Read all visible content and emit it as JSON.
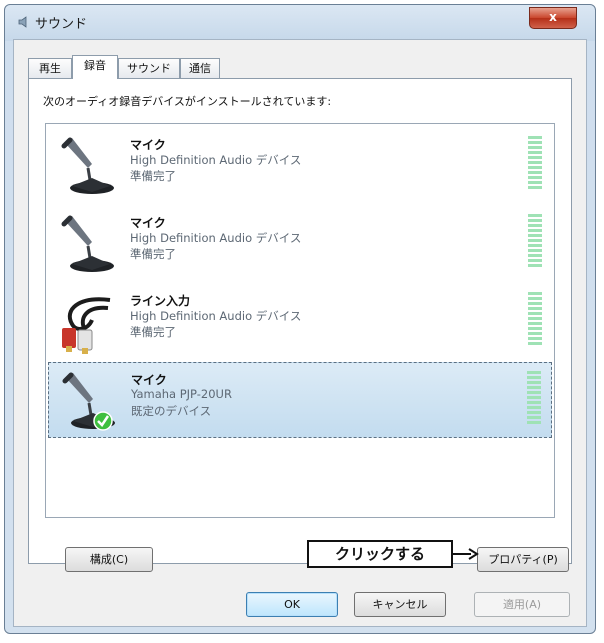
{
  "window": {
    "title": "サウンド",
    "close_label": "x"
  },
  "tabs": [
    "再生",
    "録音",
    "サウンド",
    "通信"
  ],
  "active_tab": 1,
  "caption": "次のオーディオ録音デバイスがインストールされています:",
  "devices": [
    {
      "name": "マイク",
      "description": "High Definition Audio デバイス",
      "status": "準備完了",
      "icon": "microphone-icon"
    },
    {
      "name": "マイク",
      "description": "High Definition Audio デバイス",
      "status": "準備完了",
      "icon": "microphone-icon"
    },
    {
      "name": "ライン入力",
      "description": "High Definition Audio デバイス",
      "status": "準備完了",
      "icon": "line-in-cable-icon"
    },
    {
      "name": "マイク",
      "description": "Yamaha PJP-20UR",
      "status": "既定のデバイス",
      "icon": "microphone-default-icon",
      "selected": true
    }
  ],
  "buttons": {
    "configure": "構成(C)",
    "properties": "プロパティ(P)",
    "ok": "OK",
    "cancel": "キャンセル",
    "apply": "適用(A)"
  },
  "annotation": "クリックする",
  "colors": {
    "meter": "#9fe2b5",
    "selection": "#c3dcef",
    "default_check": "#3fbf3f"
  }
}
